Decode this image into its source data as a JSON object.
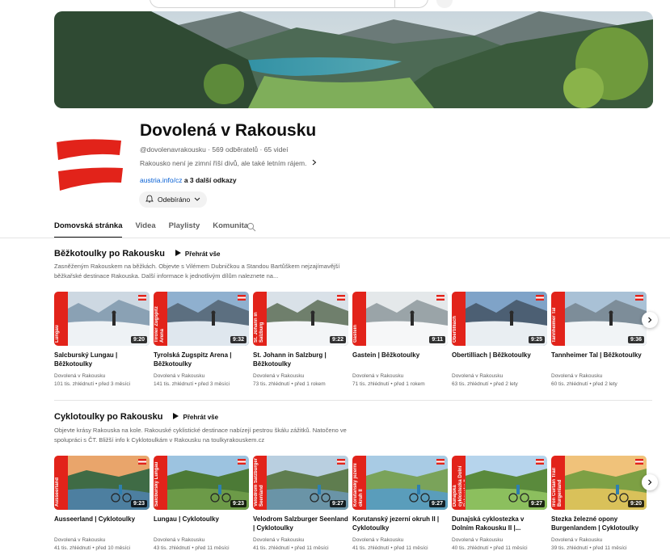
{
  "channel": {
    "title": "Dovolená v Rakousku",
    "meta": "@dovolenavrakousku · 569 odběratelů · 65 videí",
    "description": "Rakousko není je zimní říší divů, ale také letním rájem.",
    "link": "austria.info/cz",
    "more_links": " a 3 další odkazy",
    "subscribe_label": "Odebíráno"
  },
  "tabs": [
    "Domovská stránka",
    "Videa",
    "Playlisty",
    "Komunita"
  ],
  "sections": [
    {
      "title": "Běžkotoulky po Rakousku",
      "play_all": "Přehrát vše",
      "description": "Zasněženým Rakouskem na běžkách. Objevte s Vilémem Dubničkou a Standou Bartůškem nejzajímavější běžkařské destinace Rakouska. Další informace k jednotlivým dílům naleznete na...",
      "videos": [
        {
          "ribbon": "Lungau",
          "duration": "9:20",
          "title": "Salcburský Lungau | Běžkotoulky",
          "channel": "Dovolená v Rakousku",
          "stats": "101 tis. zhlédnutí • před 3 měsíci"
        },
        {
          "ribbon": "Tiroler Zugspitz Arena",
          "duration": "9:32",
          "title": "Tyrolská Zugspitz Arena | Běžkotoulky",
          "channel": "Dovolená v Rakousku",
          "stats": "141 tis. zhlédnutí • před 3 měsíci"
        },
        {
          "ribbon": "St. Johann in Salzburg",
          "duration": "9:22",
          "title": "St. Johann in Salzburg | Běžkotoulky",
          "channel": "Dovolená v Rakousku",
          "stats": "73 tis. zhlédnutí • před 1 rokem"
        },
        {
          "ribbon": "Gastein",
          "duration": "9:11",
          "title": "Gastein | Běžkotoulky",
          "channel": "Dovolená v Rakousku",
          "stats": "71 tis. zhlédnutí • před 1 rokem"
        },
        {
          "ribbon": "Obertilliach",
          "duration": "9:25",
          "title": "Obertilliach | Běžkotoulky",
          "channel": "Dovolená v Rakousku",
          "stats": "63 tis. zhlédnutí • před 2 lety"
        },
        {
          "ribbon": "Tannheimer Tal",
          "duration": "9:36",
          "title": "Tannheimer Tal | Běžkotoulky",
          "channel": "Dovolená v Rakousku",
          "stats": "60 tis. zhlédnutí • před 2 lety"
        }
      ]
    },
    {
      "title": "Cyklotoulky po Rakousku",
      "play_all": "Přehrát vše",
      "description": "Objevte krásy Rakouska na kole. Rakouské cyklistické destinace nabízejí pestrou škálu zážitků. Natočeno ve spolupráci s ČT. Bližší info k Cyklotoulkám v Rakousku na toulkyrakouskem.cz",
      "videos": [
        {
          "ribbon": "Ausseerland",
          "duration": "9:23",
          "title": "Ausseerland | Cyklotoulky",
          "channel": "Dovolená v Rakousku",
          "stats": "41 tis. zhlédnutí • před 10 měsíci"
        },
        {
          "ribbon": "Salcburský Lungau",
          "duration": "9:23",
          "title": "Lungau | Cyklotoulky",
          "channel": "Dovolená v Rakousku",
          "stats": "43 tis. zhlédnutí • před 11 měsíci"
        },
        {
          "ribbon": "Velodrom Salzburger Seenland",
          "duration": "9:27",
          "title": "Velodrom Salzburger Seenland | Cyklotoulky",
          "channel": "Dovolená v Rakousku",
          "stats": "41 tis. zhlédnutí • před 11 měsíci"
        },
        {
          "ribbon": "Korutanský jezerní okruh II",
          "duration": "9:27",
          "title": "Korutanský jezerní okruh II | Cyklotoulky",
          "channel": "Dovolená v Rakousku",
          "stats": "41 tis. zhlédnutí • před 11 měsíci"
        },
        {
          "ribbon": "Dunajská cyklostezka Dolní Rakousko II",
          "duration": "9:27",
          "title": "Dunajská cyklostezka v Dolním Rakousku II |...",
          "channel": "Dovolená v Rakousku",
          "stats": "40 tis. zhlédnutí • před 11 měsíci"
        },
        {
          "ribbon": "Iron Curtain Trail Burgenland",
          "duration": "9:20",
          "title": "Stezka železné opony Burgenlandem | Cyklotoulky",
          "channel": "Dovolená v Rakousku",
          "stats": "39 tis. zhlédnutí • před 11 měsíci"
        }
      ]
    }
  ],
  "colors": {
    "brand_red": "#e2231a",
    "link_blue": "#065fd4"
  }
}
